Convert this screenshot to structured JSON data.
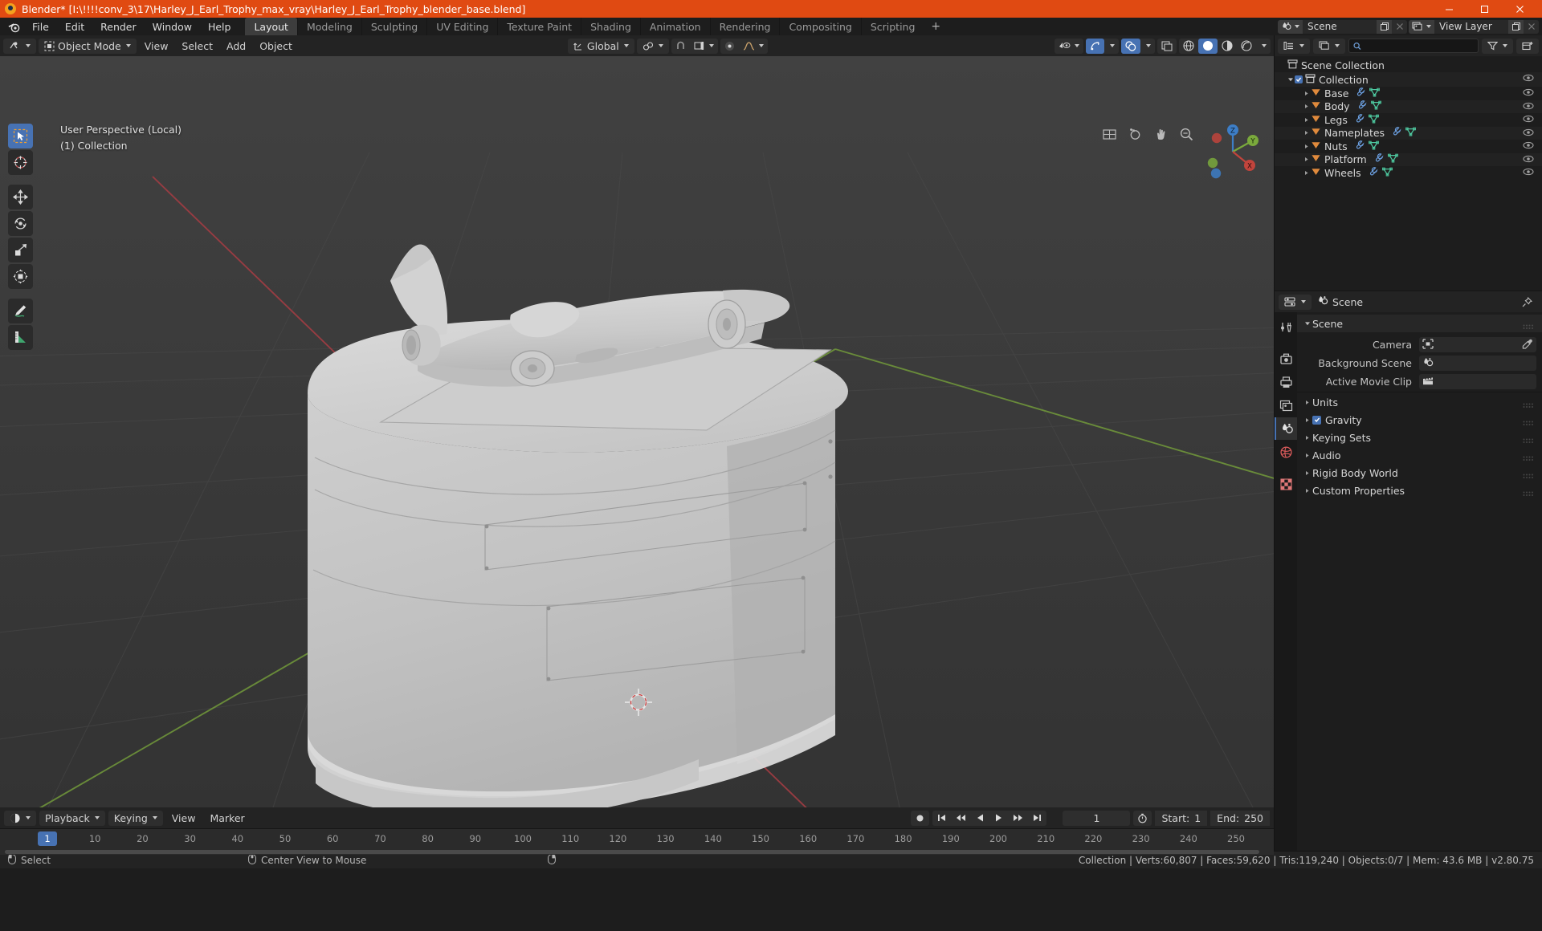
{
  "window": {
    "title": "Blender* [I:\\!!!!conv_3\\17\\Harley_J_Earl_Trophy_max_vray\\Harley_J_Earl_Trophy_blender_base.blend]",
    "minimize_label": "–",
    "maximize_label": "☐",
    "close_label": "✕"
  },
  "topbar": {
    "menus": [
      "File",
      "Edit",
      "Render",
      "Window",
      "Help"
    ],
    "workspaces": [
      {
        "label": "Layout",
        "active": true
      },
      {
        "label": "Modeling",
        "active": false
      },
      {
        "label": "Sculpting",
        "active": false
      },
      {
        "label": "UV Editing",
        "active": false
      },
      {
        "label": "Texture Paint",
        "active": false
      },
      {
        "label": "Shading",
        "active": false
      },
      {
        "label": "Animation",
        "active": false
      },
      {
        "label": "Rendering",
        "active": false
      },
      {
        "label": "Compositing",
        "active": false
      },
      {
        "label": "Scripting",
        "active": false
      }
    ],
    "add_workspace": "+",
    "scene_name": "Scene",
    "view_layer_name": "View Layer"
  },
  "viewport_header": {
    "mode": "Object Mode",
    "menus": [
      "View",
      "Select",
      "Add",
      "Object"
    ],
    "transform_orientation": "Global",
    "snap_label": "",
    "proportional_label": ""
  },
  "viewport": {
    "perspective_text": "User Perspective (Local)",
    "collection_text": "(1) Collection",
    "axis_labels": {
      "x": "X",
      "y": "Y",
      "z": "Z"
    },
    "tools": [
      {
        "name": "select-box-tool",
        "active": true
      },
      {
        "name": "cursor-tool",
        "active": false
      },
      {
        "name": "move-tool",
        "active": false
      },
      {
        "name": "rotate-tool",
        "active": false
      },
      {
        "name": "scale-tool",
        "active": false
      },
      {
        "name": "transform-tool",
        "active": false
      },
      {
        "name": "annotate-tool",
        "active": false
      },
      {
        "name": "measure-tool",
        "active": false
      }
    ]
  },
  "timeline": {
    "menus": [
      "Playback",
      "Keying",
      "View",
      "Marker"
    ],
    "current_frame": "1",
    "start_label": "Start:",
    "start_value": "1",
    "end_label": "End:",
    "end_value": "250",
    "ticks": [
      "10",
      "20",
      "30",
      "40",
      "50",
      "60",
      "70",
      "80",
      "90",
      "100",
      "110",
      "120",
      "130",
      "140",
      "150",
      "160",
      "170",
      "180",
      "190",
      "200",
      "210",
      "220",
      "230",
      "240",
      "250"
    ]
  },
  "outliner": {
    "search_placeholder": "",
    "root": "Scene Collection",
    "collection": "Collection",
    "items": [
      {
        "label": "Base"
      },
      {
        "label": "Body"
      },
      {
        "label": "Legs"
      },
      {
        "label": "Nameplates"
      },
      {
        "label": "Nuts"
      },
      {
        "label": "Platform"
      },
      {
        "label": "Wheels"
      }
    ]
  },
  "properties": {
    "breadcrumb": "Scene",
    "panels": [
      {
        "label": "Scene",
        "open": true
      },
      {
        "label": "Units",
        "open": false
      },
      {
        "label": "Gravity",
        "open": false,
        "checkbox": true
      },
      {
        "label": "Keying Sets",
        "open": false
      },
      {
        "label": "Audio",
        "open": false
      },
      {
        "label": "Rigid Body World",
        "open": false
      },
      {
        "label": "Custom Properties",
        "open": false
      }
    ],
    "rows": [
      {
        "label": "Camera",
        "value": "",
        "icon": "camera-icon",
        "eyedropper": true
      },
      {
        "label": "Background Scene",
        "value": "",
        "icon": "scene-icon",
        "eyedropper": false
      },
      {
        "label": "Active Movie Clip",
        "value": "",
        "icon": "clip-icon",
        "eyedropper": false
      }
    ]
  },
  "statusbar": {
    "left_items": [
      {
        "label": "Select",
        "mouse": "left"
      },
      {
        "label": "Center View to Mouse",
        "mouse": "middle"
      },
      {
        "label": "",
        "mouse": "right"
      }
    ],
    "stats": "Collection | Verts:60,807 | Faces:59,620 | Tris:119,240 | Objects:0/7 | Mem: 43.6 MB | v2.80.75"
  },
  "colors": {
    "accent": "#4772b3",
    "title_bar": "#e04a12",
    "panel_bg": "#1d1d1d",
    "header_bg": "#232323",
    "mesh_icon": "#4ec9a0",
    "modifier_icon": "#6b9fe0",
    "object_icon": "#e08a3c"
  }
}
